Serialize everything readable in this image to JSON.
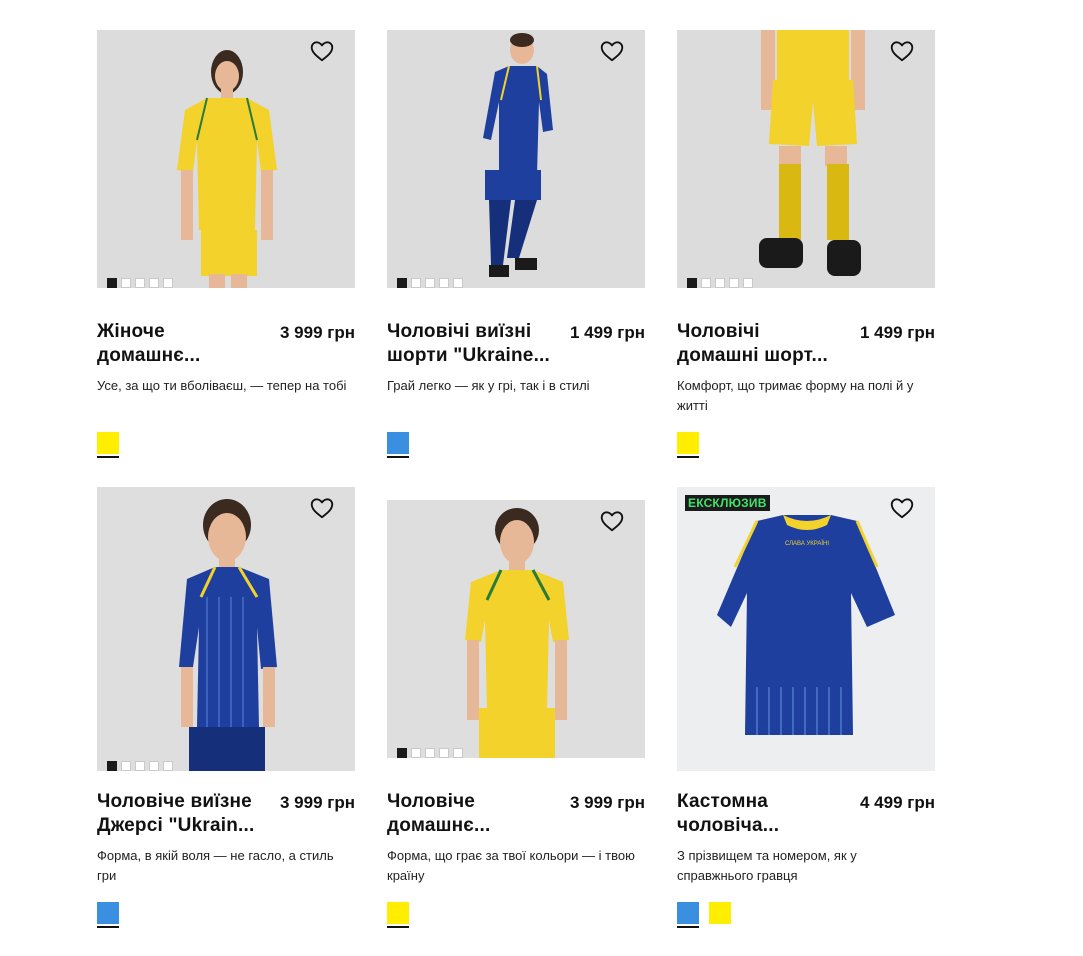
{
  "products": [
    {
      "title": "Жіноче домашнє...",
      "price": "3 999 грн",
      "description": "Усе, за що ти вболіваєш, — тепер на тобі",
      "colors": [
        "#ffee00"
      ],
      "selected_color": 0,
      "image_dots": 5,
      "active_dot": 0,
      "badge": "",
      "image": "woman in yellow home kit"
    },
    {
      "title": "Чоловічі виїзні шорти \"Ukraine...",
      "price": "1 499 грн",
      "description": "Грай легко — як у грі, так і в стилі",
      "colors": [
        "#3b8fe0"
      ],
      "selected_color": 0,
      "image_dots": 5,
      "active_dot": 0,
      "badge": "",
      "image": "man in blue away kit"
    },
    {
      "title": "Чоловічі домашні шорт...",
      "price": "1 499 грн",
      "description": "Комфорт, що тримає форму на полі й у житті",
      "colors": [
        "#ffee00"
      ],
      "selected_color": 0,
      "image_dots": 5,
      "active_dot": 0,
      "badge": "",
      "image": "yellow shorts and socks"
    },
    {
      "title": "Чоловіче виїзне Джерсі \"Ukrain...",
      "price": "3 999 грн",
      "description": "Форма, в якій воля — не гасло, а стиль гри",
      "colors": [
        "#3b8fe0"
      ],
      "selected_color": 0,
      "image_dots": 5,
      "active_dot": 0,
      "badge": "",
      "image": "man in blue away jersey"
    },
    {
      "title": "Чоловіче домашнє...",
      "price": "3 999 грн",
      "description": "Форма, що грає за твої кольори — і твою країну",
      "colors": [
        "#ffee00"
      ],
      "selected_color": 0,
      "image_dots": 5,
      "active_dot": 0,
      "badge": "",
      "image": "man in yellow home jersey"
    },
    {
      "title": "Кастомна чоловіча...",
      "price": "4 499 грн",
      "description": "З прізвищем та номером, як у справжнього гравця",
      "colors": [
        "#3b8fe0",
        "#ffee00"
      ],
      "selected_color": 0,
      "image_dots": 0,
      "active_dot": 0,
      "badge": "ЕКСКЛЮЗИВ",
      "image": "blue custom jersey",
      "jersey_text": "СЛАВА УКРАЇНІ"
    }
  ],
  "icons": {
    "favorite": "heart-outline-icon"
  }
}
